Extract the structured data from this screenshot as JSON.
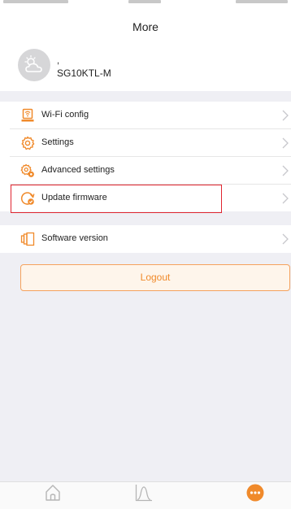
{
  "header": {
    "title": "More"
  },
  "profile": {
    "name": ",",
    "model": "SG10KTL-M"
  },
  "menu": {
    "group1": [
      {
        "label": "Wi-Fi config",
        "icon": "wifi-config-icon"
      },
      {
        "label": "Settings",
        "icon": "settings-gear-icon"
      },
      {
        "label": "Advanced settings",
        "icon": "advanced-settings-icon"
      },
      {
        "label": "Update firmware",
        "icon": "update-firmware-icon"
      }
    ],
    "group2": [
      {
        "label": "Software version",
        "icon": "software-version-icon"
      }
    ]
  },
  "logout": {
    "label": "Logout"
  },
  "colors": {
    "accent": "#f08a2b",
    "highlight": "#e0252f",
    "background": "#efeff4"
  },
  "tabbar": {
    "active": "more",
    "items": [
      {
        "key": "home",
        "icon": "home-icon"
      },
      {
        "key": "chart",
        "icon": "chart-icon"
      },
      {
        "key": "more",
        "icon": "more-dots-icon"
      }
    ]
  }
}
